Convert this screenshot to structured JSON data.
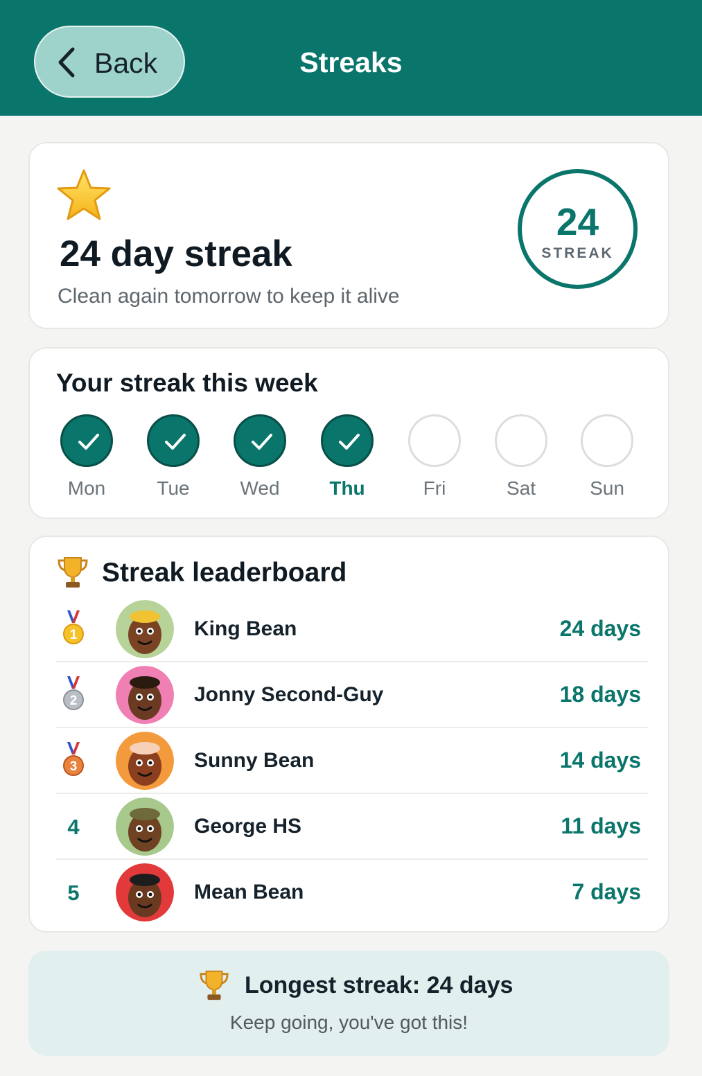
{
  "header": {
    "back_label": "Back",
    "title": "Streaks"
  },
  "streak_card": {
    "icon": "star-icon",
    "title": "24 day streak",
    "subtitle": "Clean again tomorrow to keep it alive",
    "ring_number": "24",
    "ring_label": "STREAK"
  },
  "week": {
    "title": "Your streak this week",
    "days": [
      {
        "label": "Mon",
        "done": true,
        "today": false
      },
      {
        "label": "Tue",
        "done": true,
        "today": false
      },
      {
        "label": "Wed",
        "done": true,
        "today": false
      },
      {
        "label": "Thu",
        "done": true,
        "today": true
      },
      {
        "label": "Fri",
        "done": false,
        "today": false
      },
      {
        "label": "Sat",
        "done": false,
        "today": false
      },
      {
        "label": "Sun",
        "done": false,
        "today": false
      }
    ]
  },
  "leaderboard": {
    "title": "Streak leaderboard",
    "icon": "trophy-icon",
    "entries": [
      {
        "rank": "1",
        "medal": "gold",
        "name": "King Bean",
        "days": "24 days",
        "avatar": "king-bean-avatar"
      },
      {
        "rank": "2",
        "medal": "silver",
        "name": "Jonny Second-Guy",
        "days": "18 days",
        "avatar": "jonny-second-guy-avatar"
      },
      {
        "rank": "3",
        "medal": "bronze",
        "name": "Sunny Bean",
        "days": "14 days",
        "avatar": "sunny-bean-avatar"
      },
      {
        "rank": "4",
        "medal": "",
        "name": "George HS",
        "days": "11 days",
        "avatar": "george-hs-avatar"
      },
      {
        "rank": "5",
        "medal": "",
        "name": "Mean Bean",
        "days": "7 days",
        "avatar": "mean-bean-avatar"
      }
    ]
  },
  "banner": {
    "title": "Longest streak: 24 days",
    "subtitle": "Keep going, you've got this!"
  },
  "colors": {
    "primary": "#0a756b",
    "back_button": "#9ed3cc",
    "banner_bg": "#e1efee",
    "page_bg": "#f4f4f3"
  }
}
